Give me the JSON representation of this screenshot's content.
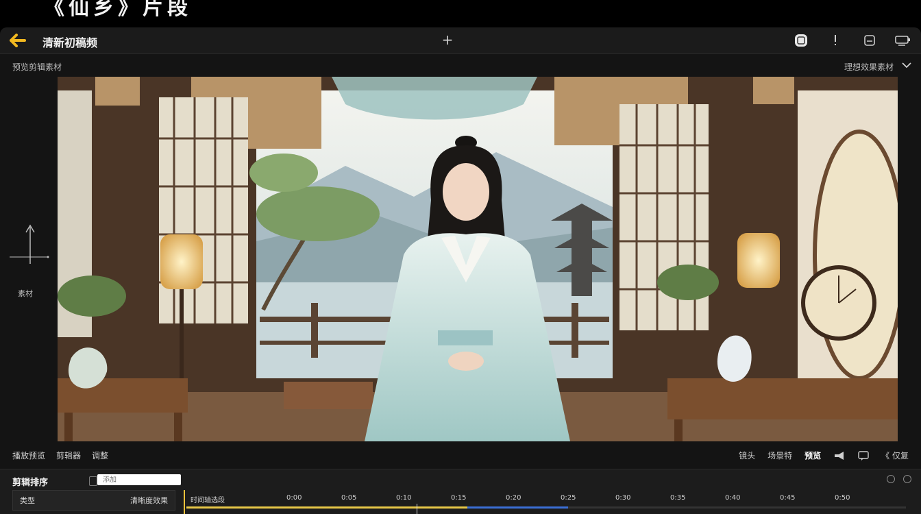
{
  "banner": {
    "text": "《仙乡》片段"
  },
  "titlebar": {
    "title": "清新初稿频",
    "plus": "+"
  },
  "preview": {
    "left_label": "预览剪辑素材",
    "right_label": "理想效果素材"
  },
  "side_tool": {
    "label": "素材"
  },
  "controls": {
    "left": [
      "播放预览",
      "剪辑器",
      "调整"
    ],
    "right": [
      "镜头",
      "场景特",
      "预览"
    ],
    "right_tail": "《 仅复"
  },
  "timeline": {
    "title": "剪辑排序",
    "search_placeholder": "添加",
    "track_left": "类型",
    "track_right": "清晰度效果",
    "ticks": [
      "时间轴选段",
      "0:00",
      "0:05",
      "0:10",
      "0:15",
      "0:20",
      "0:25",
      "0:30",
      "0:35",
      "0:40",
      "0:45",
      "0:50"
    ],
    "progress_fraction": 0.53,
    "playhead_fraction": 0.32
  },
  "colors": {
    "accent_yellow": "#f0c23b",
    "progress_blue": "#3b6fd6",
    "window_bg": "#141414"
  },
  "icons": {
    "back": "arrow-left-icon",
    "plus": "plus-icon",
    "tb1": "app-badge-icon",
    "tb2": "more-vertical-icon",
    "tb3": "save-icon",
    "tb4": "export-icon"
  }
}
